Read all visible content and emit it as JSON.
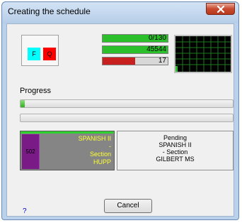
{
  "window": {
    "title": "Creating the schedule",
    "close_icon": "close-icon"
  },
  "indicators": {
    "f_label": "F",
    "q_label": "Q",
    "f_color": "#00ffff",
    "q_color": "#ff0000"
  },
  "meters": [
    {
      "text": "0/130",
      "fill_fraction": 1.0,
      "fill_color": "#2bbf2b"
    },
    {
      "text": "45544",
      "fill_fraction": 1.0,
      "fill_color": "#2bbf2b"
    },
    {
      "text": "17",
      "fill_fraction": 0.5,
      "fill_color": "#c81f1f"
    }
  ],
  "monitor": {
    "background": "#000000",
    "grid_color": "#1f7a1f",
    "accent": "#2bbf2b"
  },
  "progress": {
    "label": "Progress",
    "bar1_fraction": 0.02,
    "bar2_fraction": 0.0
  },
  "course": {
    "number": "502",
    "lines": [
      "SPANISH II",
      "-",
      "Section",
      "HUPP"
    ]
  },
  "pending": {
    "lines": [
      "Pending",
      "SPANISH II",
      "- Section",
      "GILBERT MS"
    ]
  },
  "buttons": {
    "cancel": "Cancel",
    "help": "?"
  }
}
